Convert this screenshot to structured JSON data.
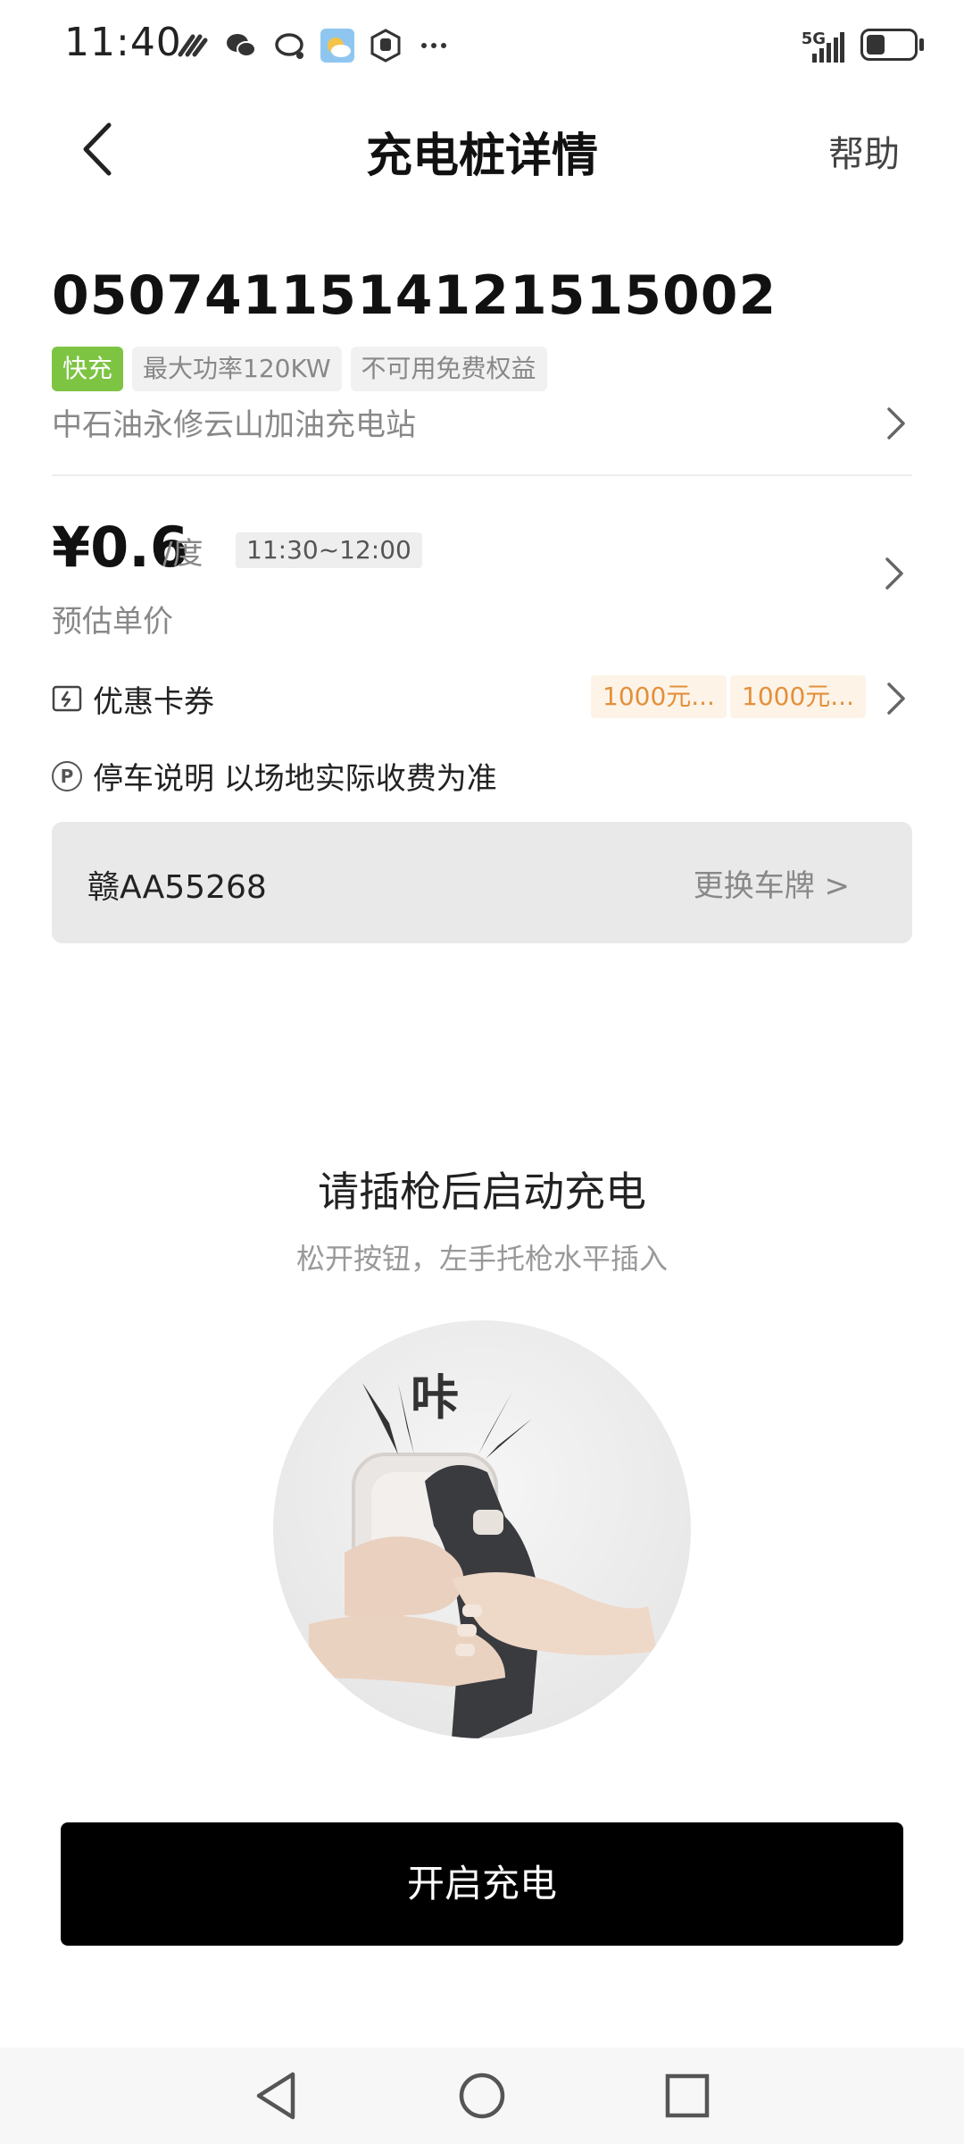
{
  "status_bar": {
    "time": "11:40",
    "network": "5G",
    "battery_level": 0.4
  },
  "header": {
    "title": "充电桩详情",
    "help_label": "帮助"
  },
  "pile": {
    "id": "0507411514121515002",
    "tags": {
      "fast": "快充",
      "power": "最大功率120KW",
      "benefit": "不可用免费权益"
    },
    "station_name": "中石油永修云山加油充电站"
  },
  "price": {
    "amount": "¥0.6",
    "unit": "/度",
    "time_range": "11:30~12:00",
    "label": "预估单价"
  },
  "coupons": {
    "label": "优惠卡券",
    "items": [
      "1000元...",
      "1000元..."
    ]
  },
  "parking": {
    "text": "停车说明 以场地实际收费为准"
  },
  "plate": {
    "number": "赣AA55268",
    "change_label": "更换车牌 >"
  },
  "plug_guide": {
    "title": "请插枪后启动充电",
    "subtitle": "松开按钮，左手托枪水平插入",
    "sound_text": "咔"
  },
  "actions": {
    "start_label": "开启充电"
  },
  "colors": {
    "fast_tag": "#7dc442",
    "coupon_text": "#e3903b",
    "coupon_bg": "#fdf3e7",
    "primary_button": "#000000"
  }
}
